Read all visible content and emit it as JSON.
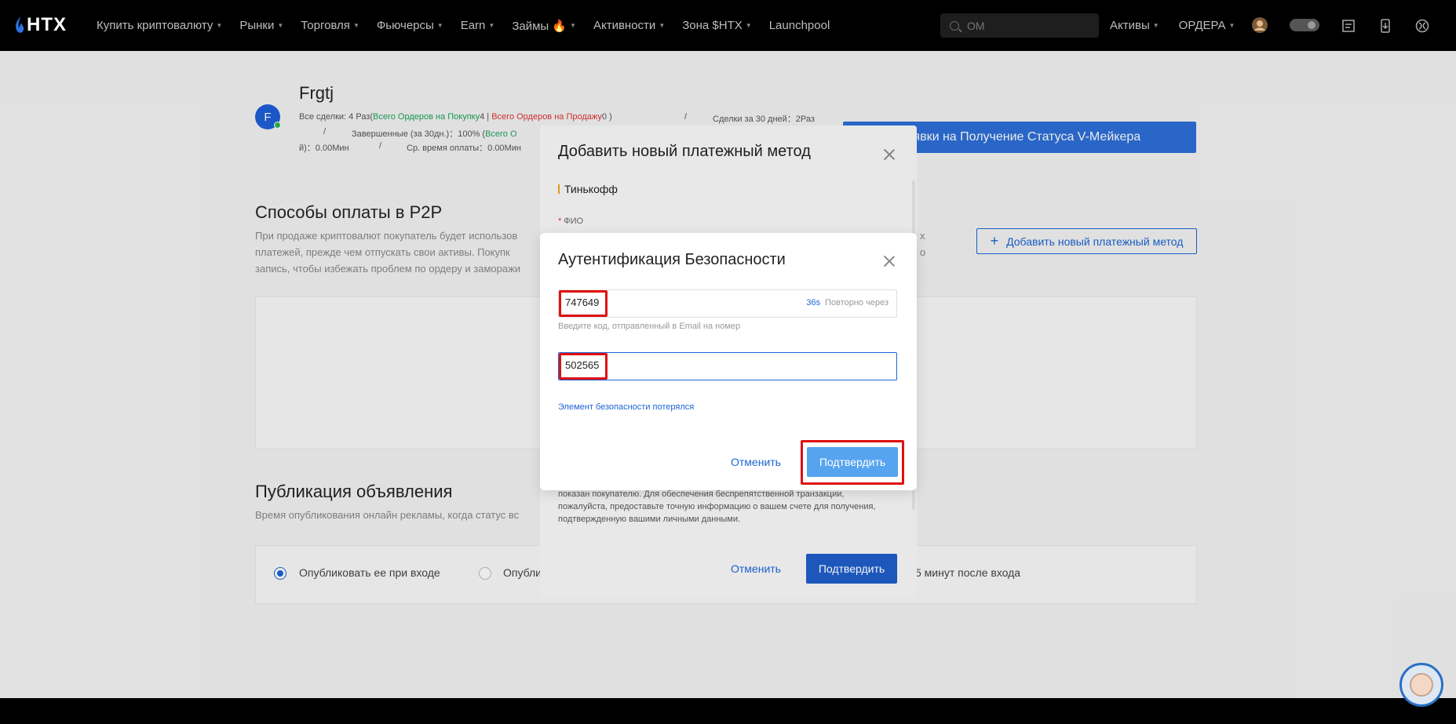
{
  "nav": {
    "logo": "HTX",
    "items": [
      {
        "label": "Купить криптовалюту",
        "caret": true
      },
      {
        "label": "Рынки",
        "caret": true
      },
      {
        "label": "Торговля",
        "caret": true
      },
      {
        "label": "Фьючерсы",
        "caret": true
      },
      {
        "label": "Earn",
        "caret": true
      },
      {
        "label": "Займы 🔥",
        "caret": true
      },
      {
        "label": "Активности",
        "caret": true
      },
      {
        "label": "Зона $HTX",
        "caret": true
      },
      {
        "label": "Launchpool",
        "caret": false
      }
    ],
    "search_placeholder": "OM",
    "assets_label": "Активы",
    "orders_label": "ОРДЕРА"
  },
  "profile": {
    "initial": "F",
    "name": "Frgtj",
    "line1_prefix": "Все сделки: 4 Раз(",
    "line1_buy_label": "Всего Ордеров на Покупку",
    "line1_buy_count": "4",
    "line1_sep": " | ",
    "line1_sell_label": "Всего Ордеров на Продажу",
    "line1_sell_count": "0 )",
    "line1_slash": "/",
    "line1_deals30": "Сделки за 30 дней：2Раз",
    "line2_slash": "/",
    "line2_completed": "Завершенные (за 30дн.)：100% (",
    "line2_green": "Всего О",
    "line3_left": "й)：0.00Мин",
    "line3_slash": "/",
    "line3_avg_pay": "Ср. время оплаты：0.00Мин",
    "vmaker_button": "Заявки на Получение Статуса V-Мейкера"
  },
  "payments_section": {
    "title": "Способы оплаты в P2P",
    "desc_line1": "При продаже криптовалют покупатель будет использов",
    "desc_line2": "платежей, прежде чем отпускать свои активы. Покупк",
    "desc_line3": "запись, чтобы избежать проблем по ордеру и заморажи",
    "desc_right1": "х",
    "desc_right2": "о",
    "add_button": "Добавить новый платежный метод"
  },
  "publish_section": {
    "title": "Публикация объявления",
    "desc": "Время опубликования онлайн рекламы, когда статус вс",
    "option1": "Опубликовать ее при входе",
    "option2": "Опублик",
    "option3_tail": "5 минут после входа"
  },
  "payment_modal": {
    "title": "Добавить новый платежный метод",
    "method": "Тинькофф",
    "fio_label": "ФИО",
    "notice": "показан покупателю. Для обеспечения беспрепятственной транзакции, пожалуйста, предоставьте точную информацию о вашем счете для получения, подтвержденную вашими личными данными.",
    "cancel": "Отменить",
    "confirm": "Подтвердить"
  },
  "security_modal": {
    "title": "Аутентификация Безопасности",
    "email_code": "747649",
    "resend_seconds": "36s",
    "resend_text": "Повторно через",
    "email_hint": "Введите код, отправленный в Email на номер",
    "ga_code": "502565",
    "lost_link": "Элемент безопасности потерялся",
    "cancel": "Отменить",
    "confirm": "Подтвердить"
  },
  "colors": {
    "accent": "#1c64d4",
    "confirm_light": "#56a4ef",
    "highlight": "#e01010"
  }
}
